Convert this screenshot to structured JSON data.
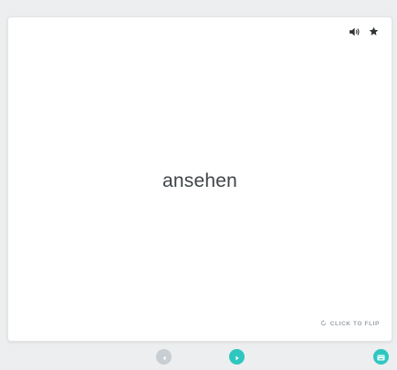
{
  "card": {
    "term": "ansehen",
    "flip_hint": "CLICK TO FLIP"
  },
  "icons": {
    "audio": "speaker-icon",
    "favorite": "star-icon",
    "flip": "rotate-icon",
    "previous": "chevron-left-icon",
    "next": "chevron-right-icon",
    "keyboard": "keyboard-icon"
  },
  "colors": {
    "accent": "#2ec7c0",
    "disabled": "#c9ced2",
    "text": "#3f4448",
    "muted": "#9aa2a8",
    "background": "#eceeef",
    "card": "#ffffff"
  }
}
